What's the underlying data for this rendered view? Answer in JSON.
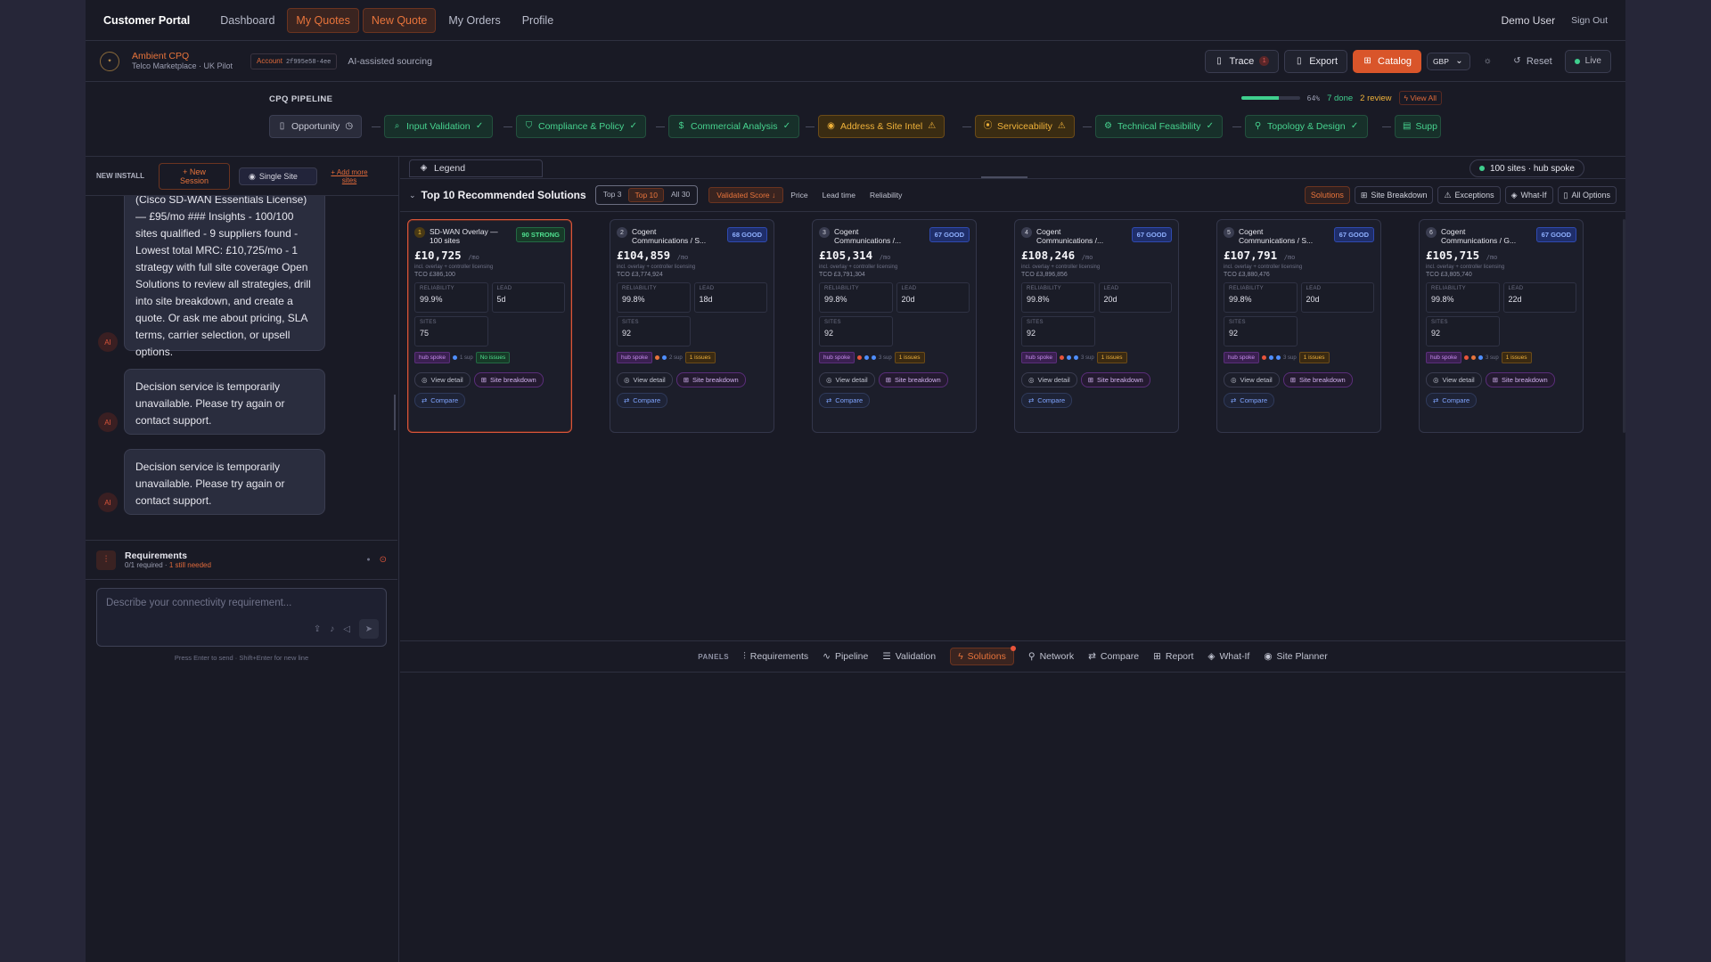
{
  "nav": {
    "brand": "Customer Portal",
    "items": [
      "Dashboard",
      "My Quotes",
      "New Quote",
      "My Orders",
      "Profile"
    ],
    "user": "Demo User",
    "signout": "Sign Out"
  },
  "context": {
    "brand_name": "Ambient CPQ",
    "brand_sub": "Telco Marketplace · UK Pilot",
    "account_label": "Account",
    "account_id": "2f995e58-4ee",
    "ai_assisted": "AI-assisted sourcing",
    "trace": "Trace",
    "trace_count": "1",
    "export": "Export",
    "catalog": "Catalog",
    "currency": "GBP",
    "reset": "Reset",
    "live": "Live"
  },
  "pipeline": {
    "title": "CPQ PIPELINE",
    "progress_percent": 64,
    "percent_label": "64%",
    "done": "7 done",
    "review": "2 review",
    "view_all": "View All",
    "stages": [
      {
        "label": "Opportunity",
        "state": "grey"
      },
      {
        "label": "Input Validation",
        "state": "green"
      },
      {
        "label": "Compliance & Policy",
        "state": "green"
      },
      {
        "label": "Commercial Analysis",
        "state": "green"
      },
      {
        "label": "Address & Site Intel",
        "state": "amber"
      },
      {
        "label": "Serviceability",
        "state": "amber"
      },
      {
        "label": "Technical Feasibility",
        "state": "green"
      },
      {
        "label": "Topology & Design",
        "state": "green"
      },
      {
        "label": "Supp",
        "state": "green"
      }
    ]
  },
  "left": {
    "new_install": "NEW INSTALL",
    "new_session": "+ New Session",
    "single_site": "Single Site",
    "add_more_sites": "+ Add more sites",
    "messages": [
      "(Cisco SD-WAN Essentials License) — £95/mo ### Insights - 100/100 sites qualified - 9 suppliers found - Lowest total MRC: £10,725/mo - 1 strategy with full site coverage Open Solutions to review all strategies, drill into site breakdown, and create a quote. Or ask me about pricing, SLA terms, carrier selection, or upsell options.",
      "Decision service is temporarily unavailable. Please try again or contact support.",
      "Decision service is temporarily unavailable. Please try again or contact support."
    ],
    "avatar": "AI",
    "requirements_title": "Requirements",
    "requirements_count": "0/1 required",
    "requirements_needed": "1 still needed",
    "input_placeholder": "Describe your connectivity requirement...",
    "hint": "Press Enter to send · Shift+Enter for new line"
  },
  "main": {
    "legend": "Legend",
    "sites_pill": "100 sites · hub spoke",
    "title": "Top 10 Recommended Solutions",
    "segments": [
      "Top 3",
      "Top 10",
      "All 30"
    ],
    "sorts": [
      "Validated Score ↓",
      "Price",
      "Lead time",
      "Reliability"
    ],
    "views": [
      "Solutions",
      "Site Breakdown",
      "Exceptions",
      "What-If",
      "All Options"
    ],
    "cards": [
      {
        "rank": "1",
        "name": "SD-WAN Overlay — 100 sites",
        "score": "90 STRONG",
        "price": "£10,725",
        "tco": "TCO £386,100",
        "reliability": "99.9%",
        "lead": "5d",
        "sites": "75",
        "issues": "No issues",
        "sup": "1 sup"
      },
      {
        "rank": "2",
        "name": "Cogent Communications / S...",
        "score": "68 GOOD",
        "price": "£104,859",
        "tco": "TCO £3,774,924",
        "reliability": "99.8%",
        "lead": "18d",
        "sites": "92",
        "issues": "1 issues",
        "sup": "2 sup"
      },
      {
        "rank": "3",
        "name": "Cogent Communications /...",
        "score": "67 GOOD",
        "price": "£105,314",
        "tco": "TCO £3,791,304",
        "reliability": "99.8%",
        "lead": "20d",
        "sites": "92",
        "issues": "1 issues",
        "sup": "3 sup"
      },
      {
        "rank": "4",
        "name": "Cogent Communications /...",
        "score": "67 GOOD",
        "price": "£108,246",
        "tco": "TCO £3,896,856",
        "reliability": "99.8%",
        "lead": "20d",
        "sites": "92",
        "issues": "1 issues",
        "sup": "3 sup"
      },
      {
        "rank": "5",
        "name": "Cogent Communications / S...",
        "score": "67 GOOD",
        "price": "£107,791",
        "tco": "TCO £3,880,476",
        "reliability": "99.8%",
        "lead": "20d",
        "sites": "92",
        "issues": "1 issues",
        "sup": "3 sup"
      },
      {
        "rank": "6",
        "name": "Cogent Communications / G...",
        "score": "67 GOOD",
        "price": "£105,715",
        "tco": "TCO £3,805,740",
        "reliability": "99.8%",
        "lead": "22d",
        "sites": "92",
        "issues": "1 issues",
        "sup": "3 sup"
      }
    ],
    "card_labels": {
      "per_month": "/mo",
      "incl": "incl. overlay + controller licensing",
      "reliability": "RELIABILITY",
      "lead": "LEAD",
      "sites": "SITES",
      "hub_spoke": "hub spoke",
      "view_detail": "View detail",
      "site_breakdown": "Site breakdown",
      "compare": "Compare"
    },
    "panels_label": "PANELS",
    "panels": [
      "Requirements",
      "Pipeline",
      "Validation",
      "Solutions",
      "Network",
      "Compare",
      "Report",
      "What-If",
      "Site Planner"
    ]
  },
  "colors": {
    "accent": "#e8743b",
    "success": "#3fcf8e",
    "warning": "#f0b23a",
    "background": "#191a25"
  }
}
